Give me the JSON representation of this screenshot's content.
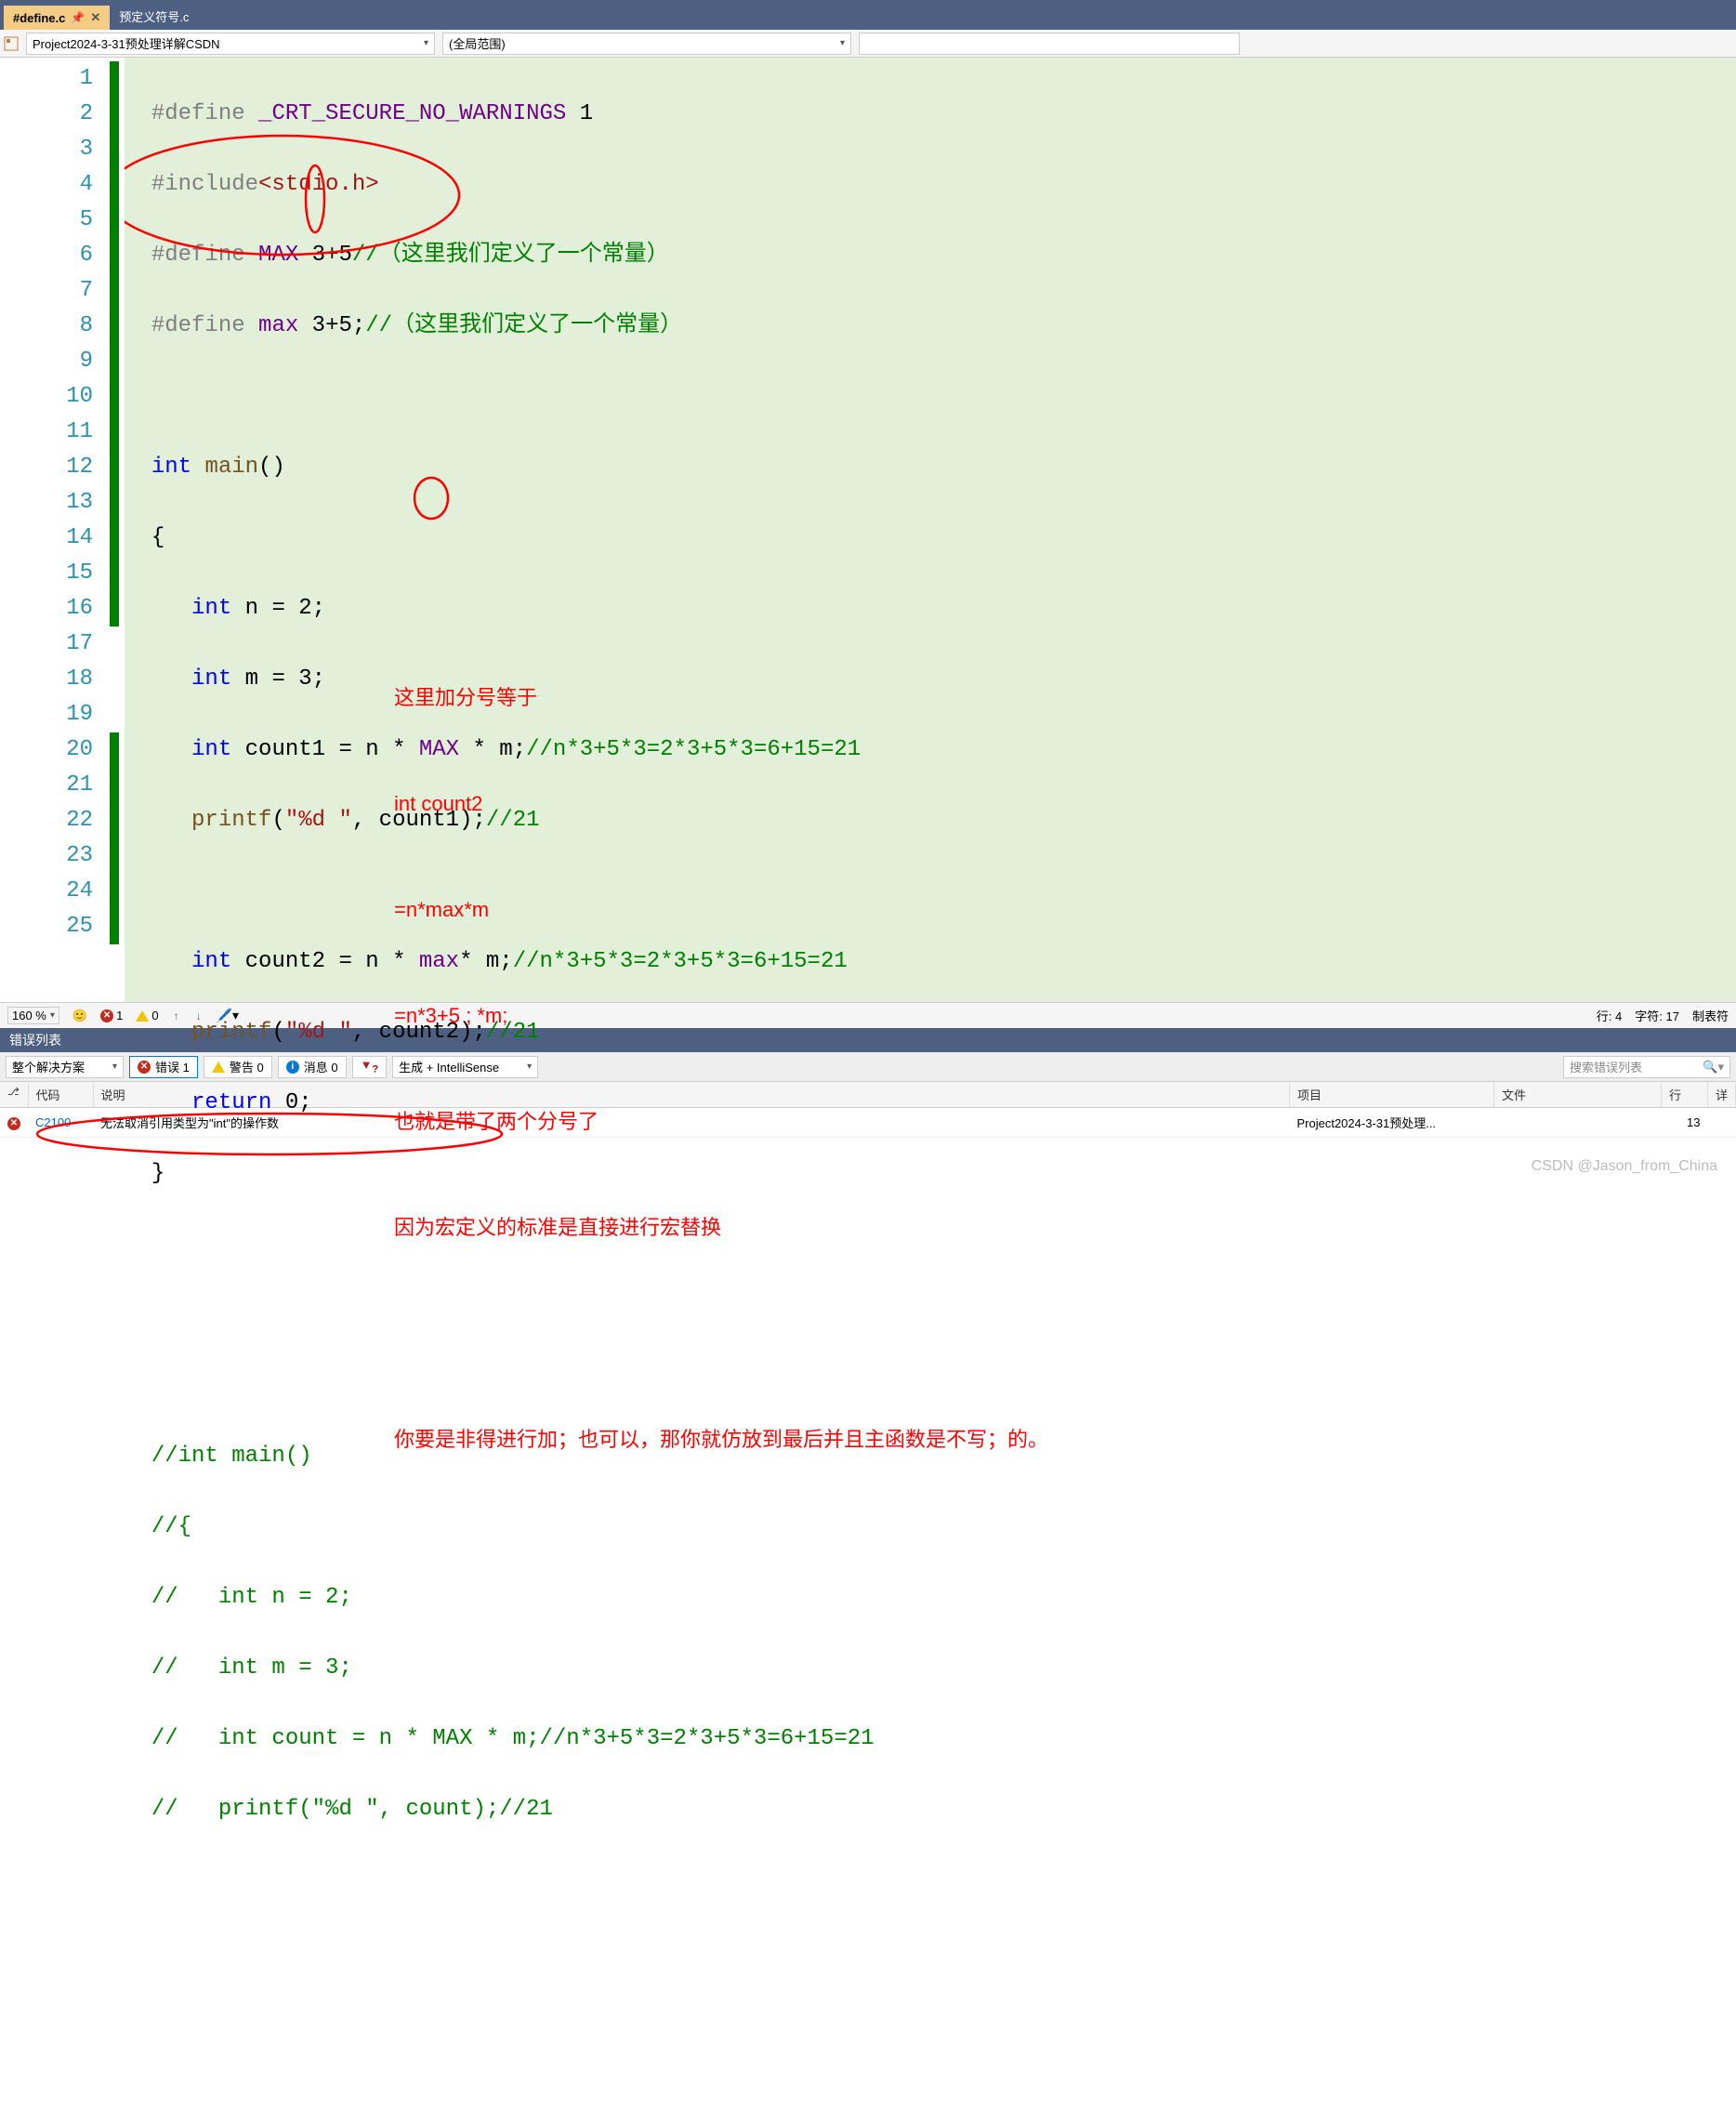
{
  "tabs": {
    "active": "#define.c",
    "inactive": "预定义符号.c"
  },
  "navbar": {
    "scope1": "Project2024-3-31预处理详解CSDN",
    "scope2": "(全局范围)"
  },
  "code": {
    "lines": [
      "1",
      "2",
      "3",
      "4",
      "5",
      "6",
      "7",
      "8",
      "9",
      "10",
      "11",
      "12",
      "13",
      "14",
      "15",
      "16",
      "17",
      "18",
      "19",
      "20",
      "21",
      "22",
      "23",
      "24",
      "25"
    ],
    "l1_def": "#define",
    "l1_mac": "_CRT_SECURE_NO_WARNINGS",
    "l1_val": "1",
    "l2_inc": "#include",
    "l2_hdr": "<stdio.h>",
    "l3_def": "#define",
    "l3_mac": "MAX",
    "l3_val": "3+5",
    "l3_cmt": "//（这里我们定义了一个常量）",
    "l4_def": "#define",
    "l4_mac": "max",
    "l4_val": "3+5;",
    "l4_cmt": "//（这里我们定义了一个常量）",
    "l6_kw": "int",
    "l6_fn": "main",
    "l6_par": "()",
    "l7": "{",
    "l8_kw": "int",
    "l8_rest": " n = 2;",
    "l9_kw": "int",
    "l9_rest": " m = 3;",
    "l10_kw": "int",
    "l10_id": " count1 = n * ",
    "l10_mac": "MAX",
    "l10_rest": " * m;",
    "l10_cmt": "//n*3+5*3=2*3+5*3=6+15=21",
    "l11_fn": "printf",
    "l11_p1": "(",
    "l11_str": "\"%d \"",
    "l11_rest": ", count1);",
    "l11_cmt": "//21",
    "l13_kw": "int",
    "l13_id": " count2 = n * ",
    "l13_mac": "max",
    "l13_rest": "* m;",
    "l13_cmt": "//n*3+5*3=2*3+5*3=6+15=21",
    "l14_fn": "printf",
    "l14_p1": "(",
    "l14_str": "\"%d \"",
    "l14_rest": ", count2);",
    "l14_cmt": "//21",
    "l15_kw": "return",
    "l15_rest": " 0;",
    "l16": "}",
    "l20_cmt": "//int main()",
    "l21_cmt": "//{",
    "l22_cmt": "//   int n = 2;",
    "l23_cmt": "//   int m = 3;",
    "l24_cmt": "//   int count = n * MAX * m;//n*3+5*3=2*3+5*3=6+15=21",
    "l25_cmt": "//   printf(\"%d \", count);//21"
  },
  "annot": {
    "a1": "这里加分号等于",
    "a2": "int count2",
    "a3": "=n*max*m",
    "a4": "=n*3+5 ; *m;",
    "a5": "也就是带了两个分号了",
    "a6": "因为宏定义的标准是直接进行宏替换",
    "a7": "你要是非得进行加；也可以，那你就仿放到最后并且主函数是不写；的。"
  },
  "status": {
    "zoom": "160 %",
    "err_count": "1",
    "warn_count": "0",
    "line_label": "行:",
    "line_val": "4",
    "char_label": "字符:",
    "char_val": "17",
    "tabs": "制表符"
  },
  "errlist": {
    "title": "错误列表",
    "scope": "整个解决方案",
    "btn_err": "错误 1",
    "btn_warn": "警告 0",
    "btn_msg": "消息 0",
    "build": "生成 + IntelliSense",
    "search_ph": "搜索错误列表",
    "headers": {
      "code": "代码",
      "desc": "说明",
      "proj": "项目",
      "file": "文件",
      "line": "行",
      "suppr": "详"
    },
    "row": {
      "code": "C2100",
      "desc": "无法取消引用类型为\"int\"的操作数",
      "proj": "Project2024-3-31预处理...",
      "file": "",
      "line": "13"
    }
  },
  "watermark": "CSDN @Jason_from_China"
}
